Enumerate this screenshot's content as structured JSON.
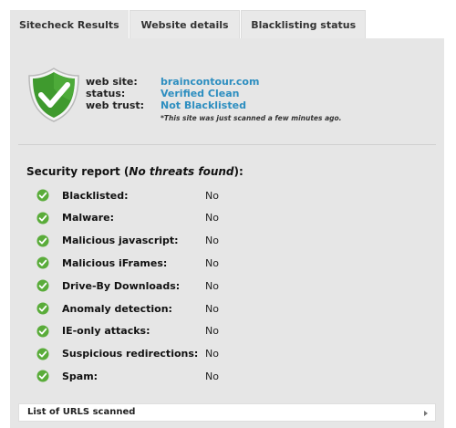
{
  "tabs": [
    {
      "label": "Sitecheck Results",
      "active": true
    },
    {
      "label": "Website details",
      "active": false
    },
    {
      "label": "Blacklisting status",
      "active": false
    }
  ],
  "site": {
    "website_label": "web site:",
    "website_value": "braincontour.com",
    "status_label": "status:",
    "status_value": "Verified Clean",
    "trust_label": "web trust:",
    "trust_value": "Not Blacklisted",
    "scan_note": "*This site was just scanned a few minutes ago."
  },
  "report": {
    "title_prefix": "Security report (",
    "title_italic": "No threats found",
    "title_suffix": "):",
    "checks": [
      {
        "label": "Blacklisted:",
        "value": "No"
      },
      {
        "label": "Malware:",
        "value": "No"
      },
      {
        "label": "Malicious javascript:",
        "value": "No"
      },
      {
        "label": "Malicious iFrames:",
        "value": "No"
      },
      {
        "label": "Drive-By Downloads:",
        "value": "No"
      },
      {
        "label": "Anomaly detection:",
        "value": "No"
      },
      {
        "label": "IE-only attacks:",
        "value": "No"
      },
      {
        "label": "Suspicious redirections:",
        "value": "No"
      },
      {
        "label": "Spam:",
        "value": "No"
      }
    ]
  },
  "urls_label": "List of URLS scanned",
  "icons": {
    "shield": "shield-check-icon",
    "check": "check-circle-icon",
    "arrow": "chevron-right-icon"
  },
  "colors": {
    "link": "#2d8ec0",
    "shield_green": "#3f9a2e",
    "check_green": "#5aac3a",
    "panel": "#e6e6e6"
  }
}
